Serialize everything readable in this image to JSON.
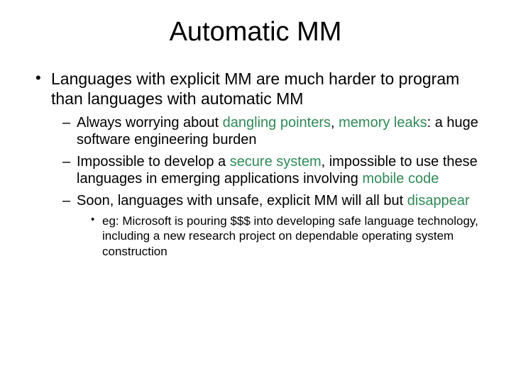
{
  "title": "Automatic MM",
  "bullet1_a": "Languages with explicit MM are much harder to program than languages with automatic MM",
  "sub1_a": "Always worrying about ",
  "sub1_hl1": "dangling pointers",
  "sub1_b": ", ",
  "sub1_hl2": "memory leaks",
  "sub1_c": ":  a huge software engineering burden",
  "sub2_a": "Impossible to develop a ",
  "sub2_hl1": "secure system",
  "sub2_b": ", impossible to use these languages in emerging applications involving ",
  "sub2_hl2": "mobile code",
  "sub3_a": "Soon, languages with unsafe, explicit MM will all but ",
  "sub3_hl1": "disappear",
  "subsub_a": "eg:  Microsoft is pouring $$$ into developing safe language technology, including a new research project on dependable operating system construction"
}
